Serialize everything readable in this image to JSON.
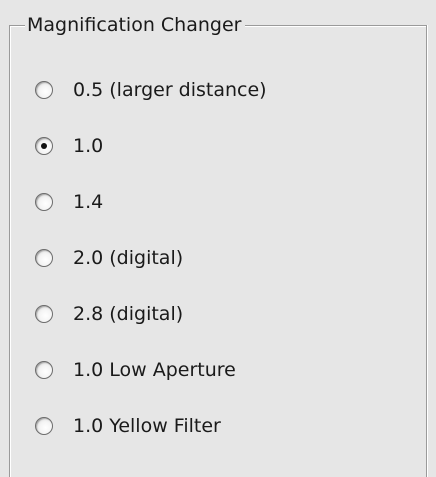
{
  "group": {
    "title": "Magnification Changer"
  },
  "options": [
    {
      "label": "0.5 (larger distance)",
      "checked": false
    },
    {
      "label": "1.0",
      "checked": true
    },
    {
      "label": "1.4",
      "checked": false
    },
    {
      "label": "2.0 (digital)",
      "checked": false
    },
    {
      "label": "2.8 (digital)",
      "checked": false
    },
    {
      "label": "1.0 Low Aperture",
      "checked": false
    },
    {
      "label": "1.0 Yellow Filter",
      "checked": false
    }
  ]
}
